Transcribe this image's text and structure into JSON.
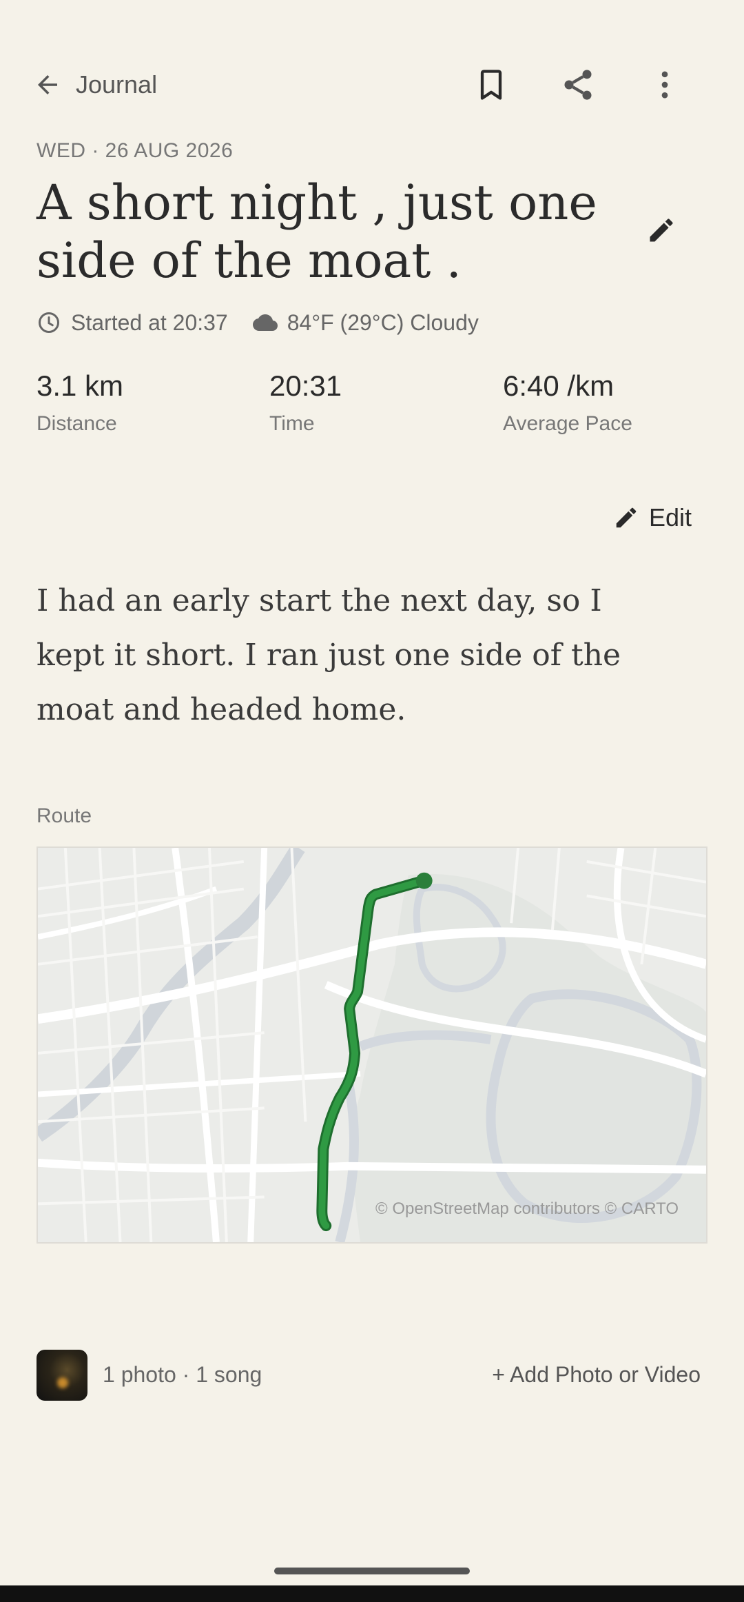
{
  "header": {
    "back_label": "Journal"
  },
  "entry": {
    "date": "WED · 26 AUG 2026",
    "title": "A short night , just one side of the moat .",
    "started_at": "Started at 20:37",
    "weather": "84°F (29°C) Cloudy",
    "stats": [
      {
        "value": "3.1 km",
        "label": "Distance"
      },
      {
        "value": "20:31",
        "label": "Time"
      },
      {
        "value": "6:40 /km",
        "label": "Average Pace"
      }
    ],
    "edit_label": "Edit",
    "body": "I had an early start the next day, so I kept it short. I ran just one side of the moat and headed home."
  },
  "route": {
    "label": "Route",
    "attribution": "© OpenStreetMap contributors © CARTO",
    "route_color": "#2e8b3e"
  },
  "media": {
    "count_text": "1 photo · 1 song",
    "add_label": "+ Add Photo or Video"
  },
  "icons": {
    "back": "arrow-left-icon",
    "bookmark": "bookmark-icon",
    "share": "share-icon",
    "more": "more-vertical-icon",
    "edit": "pencil-icon",
    "clock": "clock-icon",
    "weather": "cloud-icon"
  }
}
